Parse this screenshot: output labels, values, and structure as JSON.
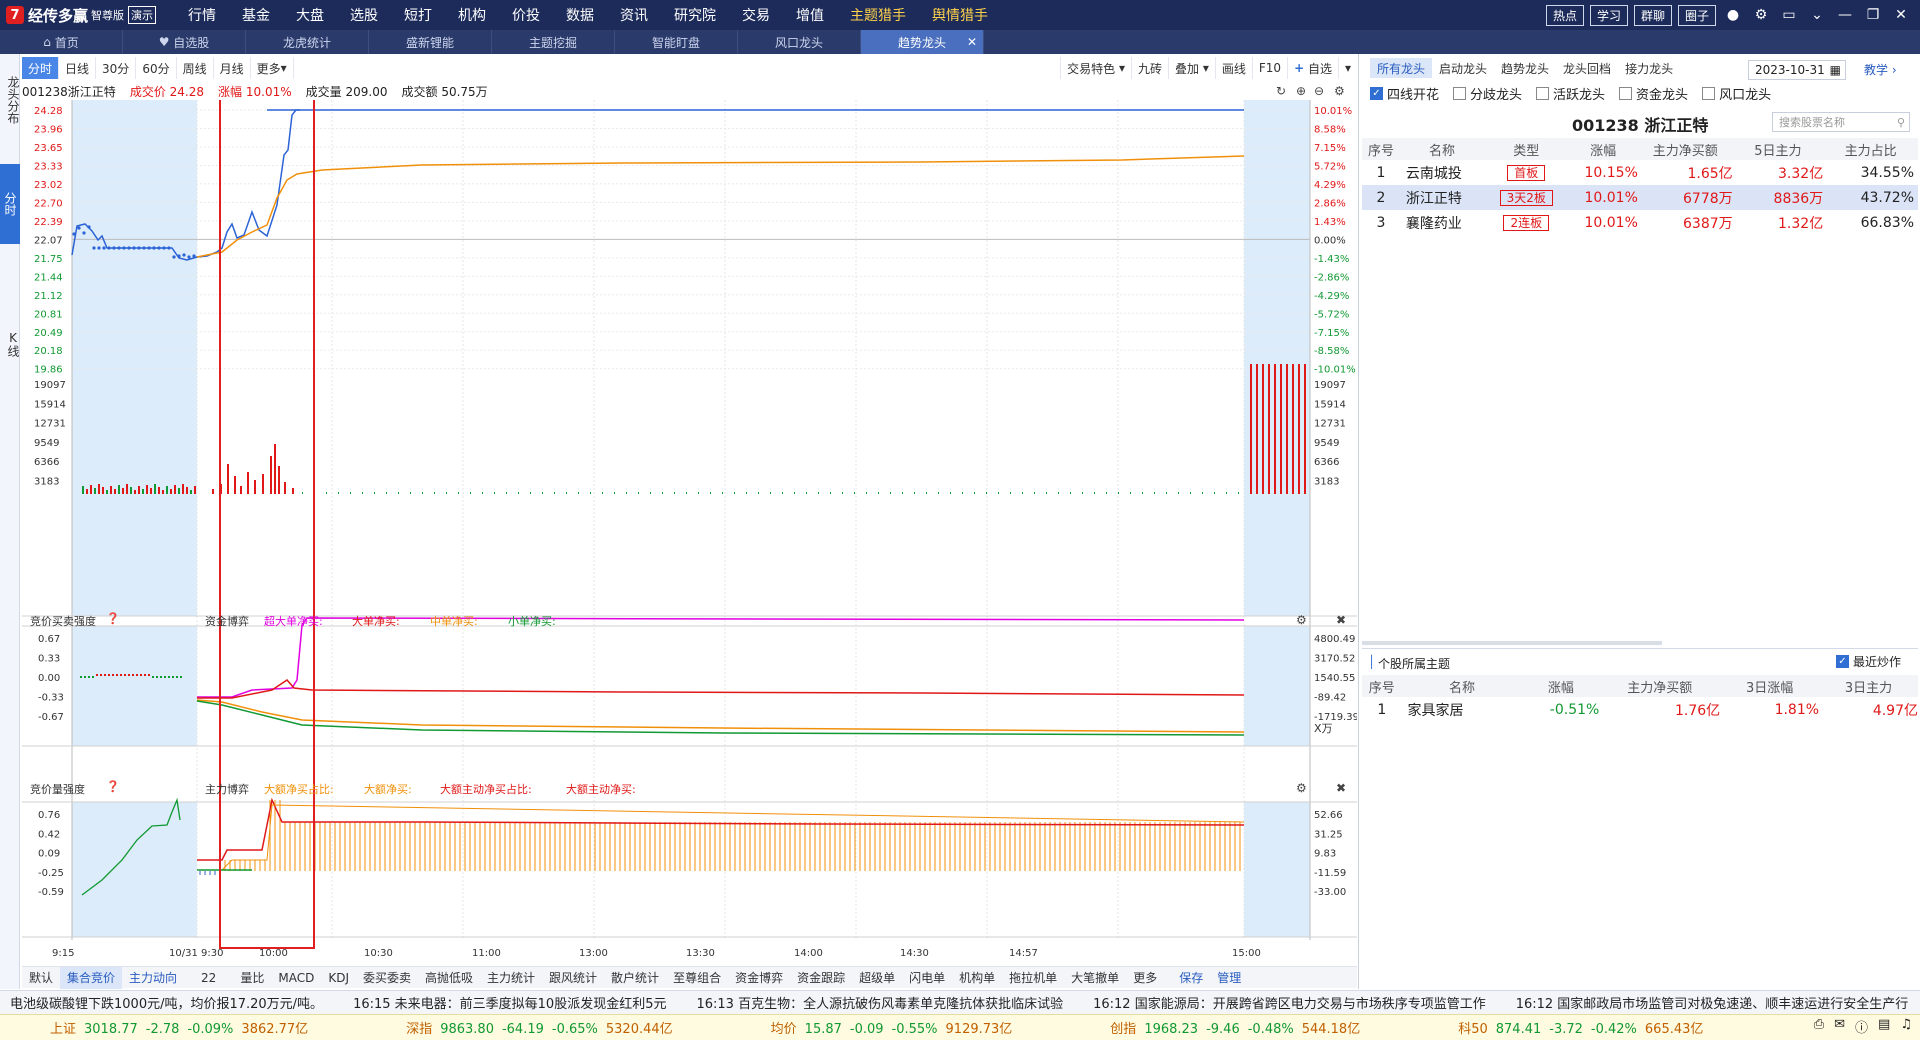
{
  "app": {
    "logo_text": "经传多赢",
    "edition": "智尊版",
    "demo": "演示"
  },
  "menu": [
    "行情",
    "基金",
    "大盘",
    "选股",
    "短打",
    "机构",
    "价投",
    "数据",
    "资讯",
    "研究院",
    "交易",
    "增值",
    "主题猎手",
    "舆情猎手"
  ],
  "top_buttons": [
    "热点",
    "学习",
    "群聊",
    "圈子"
  ],
  "tabs": [
    "首页",
    "自选股",
    "龙虎统计",
    "盛新锂能",
    "主题挖掘",
    "智能盯盘",
    "风口龙头",
    "趋势龙头"
  ],
  "left_nav": {
    "top": "龙头分布",
    "intraday": "分时",
    "kline": "K线"
  },
  "periods": [
    "分时",
    "日线",
    "30分",
    "60分",
    "周线",
    "月线",
    "更多"
  ],
  "chart_tools": [
    "交易特色",
    "九砖",
    "叠加",
    "画线",
    "F10",
    "自选"
  ],
  "stock_info": {
    "code_name": "001238浙江正特",
    "price_label": "成交价",
    "price": "24.28",
    "change_label": "涨幅",
    "change": "10.01%",
    "volume_label": "成交量",
    "volume": "209.00",
    "amount_label": "成交额",
    "amount": "50.75万"
  },
  "price_axis_left": [
    "24.28",
    "23.96",
    "23.65",
    "23.33",
    "23.02",
    "22.70",
    "22.39",
    "22.07",
    "21.75",
    "21.44",
    "21.12",
    "20.81",
    "20.49",
    "20.18",
    "19.86"
  ],
  "price_axis_right": [
    "10.01%",
    "8.58%",
    "7.15%",
    "5.72%",
    "4.29%",
    "2.86%",
    "1.43%",
    "0.00%",
    "-1.43%",
    "-2.86%",
    "-4.29%",
    "-5.72%",
    "-7.15%",
    "-8.58%",
    "-10.01%"
  ],
  "volume_axis": [
    "19097",
    "15914",
    "12731",
    "9549",
    "6366",
    "3183"
  ],
  "panel2": {
    "title": "竞价买卖强度",
    "center": "资金博弈",
    "legend": [
      "超大单净买:",
      "大单净买:",
      "中单净买:",
      "小单净买:"
    ],
    "left_axis": [
      "0.67",
      "0.33",
      "0.00",
      "-0.33",
      "-0.67"
    ],
    "right_axis": [
      "4800.49",
      "3170.52",
      "1540.55",
      "-89.42",
      "-1719.39"
    ],
    "unit": "X万"
  },
  "panel3": {
    "title": "竞价量强度",
    "center": "主力博弈",
    "legend": [
      "大额净买占比:",
      "大额净买:",
      "大额主动净买占比:",
      "大额主动净买:"
    ],
    "left_axis": [
      "0.76",
      "0.42",
      "0.09",
      "-0.25",
      "-0.59"
    ],
    "right_axis": [
      "52.66",
      "31.25",
      "9.83",
      "-11.59",
      "-33.00"
    ]
  },
  "time_axis": [
    "9:15",
    "10/31 9:30",
    "10:00",
    "10:30",
    "11:00",
    "13:00",
    "13:30",
    "14:00",
    "14:30",
    "14:57",
    "15:00"
  ],
  "bottom_tabs": [
    "默认",
    "集合竞价",
    "主力动向",
    "22",
    "量比",
    "MACD",
    "KDJ",
    "委买委卖",
    "高抛低吸",
    "主力统计",
    "跟风统计",
    "散户统计",
    "至尊组合",
    "资金博弈",
    "资金跟踪",
    "超级单",
    "闪电单",
    "机构单",
    "拖拉机单",
    "大笔撤单",
    "更多",
    "保存",
    "管理"
  ],
  "right": {
    "tabs": [
      "所有龙头",
      "启动龙头",
      "趋势龙头",
      "龙头回档",
      "接力龙头"
    ],
    "date": "2023-10-31",
    "teach": "教学",
    "checks": [
      {
        "label": "四线开花",
        "on": true
      },
      {
        "label": "分歧龙头",
        "on": false
      },
      {
        "label": "活跃龙头",
        "on": false
      },
      {
        "label": "资金龙头",
        "on": false
      },
      {
        "label": "风口龙头",
        "on": false
      }
    ],
    "stock_title": "001238  浙江正特",
    "search_placeholder": "搜索股票名称",
    "table_headers": [
      "序号",
      "名称",
      "类型",
      "涨幅",
      "主力净买额",
      "5日主力",
      "主力占比"
    ],
    "rows": [
      [
        "1",
        "云南城投",
        "首板",
        "10.15%",
        "1.65亿",
        "3.32亿",
        "34.55%"
      ],
      [
        "2",
        "浙江正特",
        "3天2板",
        "10.01%",
        "6778万",
        "8836万",
        "43.72%"
      ],
      [
        "3",
        "襄隆药业",
        "2连板",
        "10.01%",
        "6387万",
        "1.32亿",
        "66.83%"
      ]
    ],
    "theme_title": "个股所属主题",
    "recent_label": "最近炒作",
    "theme_headers": [
      "序号",
      "名称",
      "涨幅",
      "主力净买额",
      "3日涨幅",
      "3日主力"
    ],
    "theme_rows": [
      [
        "1",
        "家具家居",
        "-0.51%",
        "1.76亿",
        "1.81%",
        "4.97亿"
      ]
    ]
  },
  "news": [
    "电池级碳酸锂下跌1000元/吨，均价报17.20万元/吨。",
    "16:15 未来电器：前三季度拟每10股派发现金红利5元",
    "16:13 百克生物：全人源抗破伤风毒素单克隆抗体获批临床试验",
    "16:12 国家能源局：开展跨省跨区电力交易与市场秩序专项监管工作",
    "16:12 国家邮政局市场监管司对极兔速递、顺丰速运进行安全生产行"
  ],
  "indices": [
    {
      "name": "上证",
      "value": "3018.77",
      "chg": "-2.78",
      "pct": "-0.09%",
      "amt": "3862.77亿"
    },
    {
      "name": "深指",
      "value": "9863.80",
      "chg": "-64.19",
      "pct": "-0.65%",
      "amt": "5320.44亿"
    },
    {
      "name": "均价",
      "value": "15.87",
      "chg": "-0.09",
      "pct": "-0.55%",
      "amt": "9129.73亿"
    },
    {
      "name": "创指",
      "value": "1968.23",
      "chg": "-9.46",
      "pct": "-0.48%",
      "amt": "544.18亿"
    },
    {
      "name": "科50",
      "value": "874.41",
      "chg": "-3.72",
      "pct": "-0.42%",
      "amt": "665.43亿"
    }
  ],
  "colors": {
    "price_line": "#2c63d6",
    "avg_line": "#f0900a",
    "up": "#e01818",
    "down": "#119933",
    "magenta": "#e000e0",
    "highlight_box": "#e02020",
    "auction_bg": "#dcecfa"
  },
  "zoom": "100%"
}
